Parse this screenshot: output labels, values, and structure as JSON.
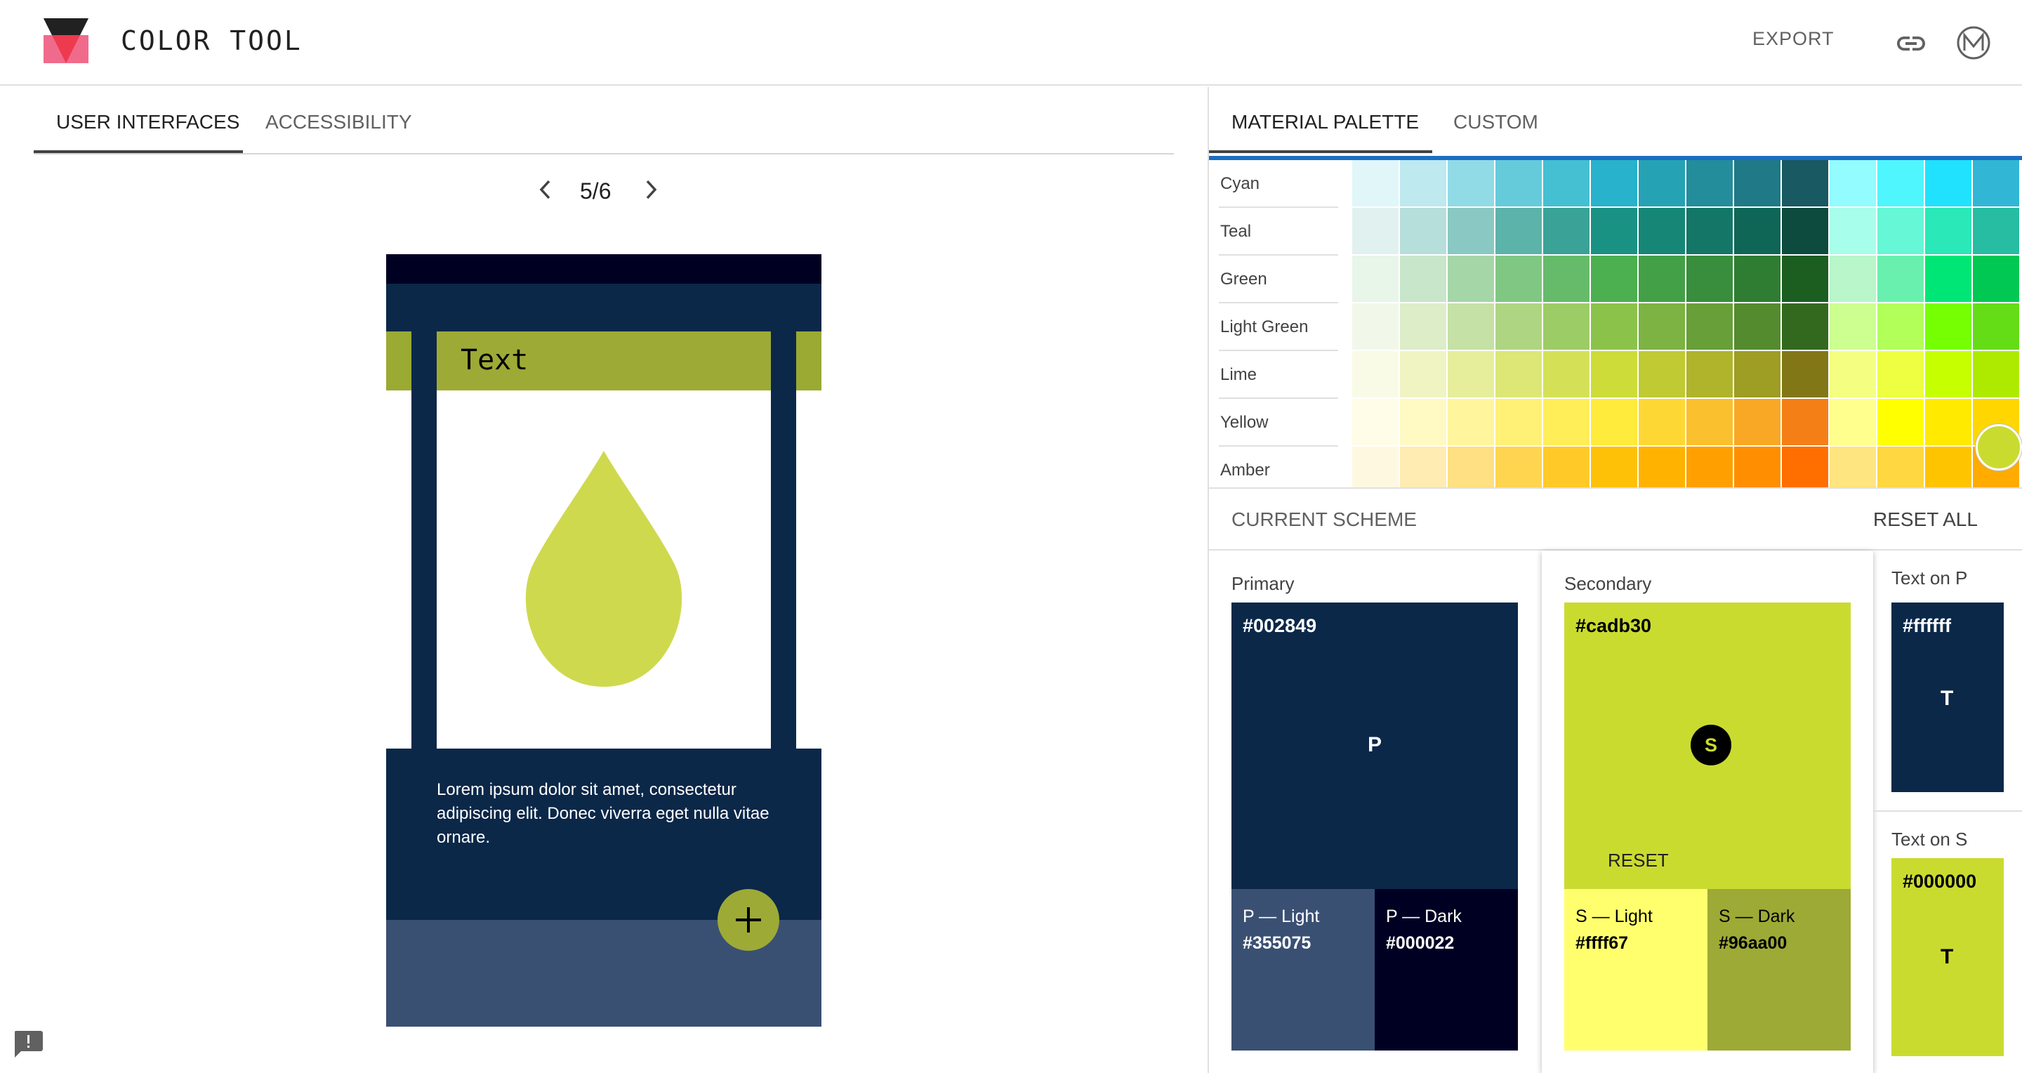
{
  "app": {
    "title": "COLOR TOOL",
    "export_label": "EXPORT",
    "icons": [
      "logo-icon",
      "link-icon",
      "material-m-icon",
      "feedback-icon"
    ]
  },
  "left": {
    "tabs": [
      {
        "label": "USER INTERFACES",
        "active": true
      },
      {
        "label": "ACCESSIBILITY",
        "active": false
      }
    ],
    "pager": {
      "text": "5/6"
    },
    "phone": {
      "card_title": "Text",
      "body_text": "Lorem ipsum dolor sit amet, consectetur adipiscing elit. Donec viverra eget nulla vitae ornare."
    }
  },
  "right": {
    "tabs": [
      {
        "label": "MATERIAL PALETTE",
        "active": true
      },
      {
        "label": "CUSTOM",
        "active": false
      }
    ],
    "palette": [
      {
        "name": "Cyan",
        "colors": [
          "#e0f6f9",
          "#bde9ef",
          "#91dbe6",
          "#65cbdb",
          "#45bfd2",
          "#28b2cb",
          "#26a2b5",
          "#238d9c",
          "#207986",
          "#195962",
          "#92fcfe",
          "#4ff6fe",
          "#20e2fe",
          "#32b6d6"
        ]
      },
      {
        "name": "Teal",
        "colors": [
          "#e1f1f0",
          "#b6dedb",
          "#8ac8c3",
          "#5cb3aa",
          "#3aa297",
          "#1a9283",
          "#168677",
          "#137667",
          "#0f6657",
          "#0c4b3e",
          "#a7feea",
          "#65f7d6",
          "#2be8b8",
          "#26bda2"
        ]
      },
      {
        "name": "Green",
        "colors": [
          "#e8f5e9",
          "#c8e6c9",
          "#a5d6a7",
          "#81c784",
          "#66bb6a",
          "#4caf50",
          "#43a047",
          "#388e3c",
          "#2e7d32",
          "#1b5e20",
          "#b9f6ca",
          "#69f0ae",
          "#00e676",
          "#00c853"
        ]
      },
      {
        "name": "Light Green",
        "colors": [
          "#f1f8e9",
          "#dcedc8",
          "#c5e1a5",
          "#aed581",
          "#9ccc65",
          "#8bc34a",
          "#7cb342",
          "#689f38",
          "#558b2f",
          "#33691e",
          "#ccff90",
          "#b2ff59",
          "#76ff03",
          "#64dd17"
        ]
      },
      {
        "name": "Lime",
        "colors": [
          "#f9fbe7",
          "#f0f4c3",
          "#e6ee9c",
          "#dce775",
          "#d4e157",
          "#cddc39",
          "#c0ca33",
          "#afb42b",
          "#9e9d24",
          "#827717",
          "#f4ff81",
          "#eeff41",
          "#c6ff00",
          "#aeea00"
        ]
      },
      {
        "name": "Yellow",
        "colors": [
          "#fffde7",
          "#fff9c4",
          "#fff59d",
          "#fff176",
          "#ffee58",
          "#ffeb3b",
          "#fdd835",
          "#fbc02d",
          "#f9a825",
          "#f57f17",
          "#ffff8d",
          "#ffff00",
          "#ffea00",
          "#ffd600"
        ]
      },
      {
        "name": "Amber",
        "colors": [
          "#fff8e1",
          "#ffecb3",
          "#ffe082",
          "#ffd54f",
          "#ffca28",
          "#ffc107",
          "#ffb300",
          "#ffa000",
          "#ff8f00",
          "#ff6f00",
          "#ffe57f",
          "#ffd740",
          "#ffc400",
          "#ffab00"
        ]
      }
    ],
    "scheme": {
      "title": "CURRENT SCHEME",
      "reset_all": "RESET ALL",
      "primary": {
        "label": "Primary",
        "hex": "#002849",
        "letter": "P",
        "light_label": "P — Light",
        "light_hex": "#355075",
        "dark_label": "P — Dark",
        "dark_hex": "#000022"
      },
      "secondary": {
        "label": "Secondary",
        "hex": "#cadb30",
        "letter": "S",
        "reset": "RESET",
        "light_label": "S — Light",
        "light_hex": "#ffff67",
        "dark_label": "S — Dark",
        "dark_hex": "#96aa00"
      },
      "text_on_p": {
        "label": "Text on P",
        "hex": "#ffffff",
        "letter": "T"
      },
      "text_on_s": {
        "label": "Text on S",
        "hex": "#000000",
        "letter": "T"
      }
    }
  }
}
